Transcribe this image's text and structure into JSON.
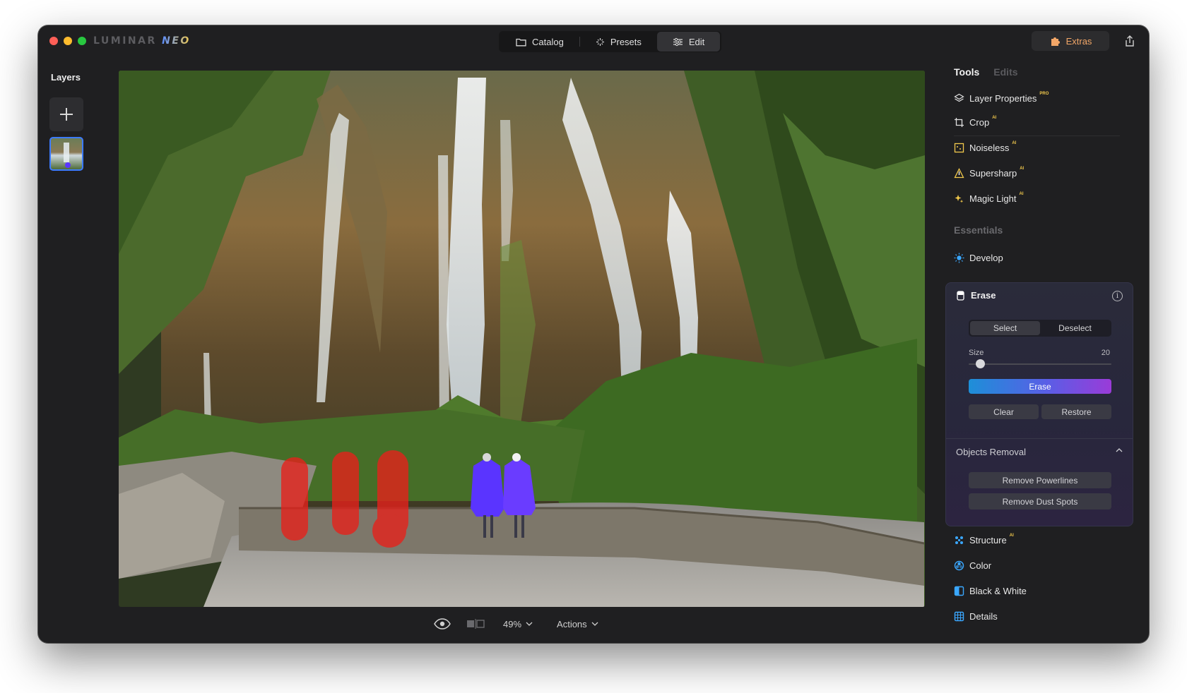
{
  "app": {
    "logo_main": "LUMINAR ",
    "logo_accent": "NEO"
  },
  "modes": [
    {
      "label": "Catalog",
      "icon": "folder-icon",
      "active": false
    },
    {
      "label": "Presets",
      "icon": "sparkle-icon",
      "active": false
    },
    {
      "label": "Edit",
      "icon": "sliders-icon",
      "active": true
    }
  ],
  "extras": {
    "label": "Extras",
    "icon": "puzzle-icon"
  },
  "layers": {
    "title": "Layers"
  },
  "bottombar": {
    "zoom": "49%",
    "actions": "Actions"
  },
  "panel": {
    "tabs": {
      "tools": "Tools",
      "edits": "Edits"
    },
    "tools": [
      {
        "label": "Layer Properties",
        "badge": "PRO"
      },
      {
        "label": "Crop",
        "badge": "AI"
      },
      {
        "label": "Noiseless",
        "badge": "AI"
      },
      {
        "label": "Supersharp",
        "badge": "AI"
      },
      {
        "label": "Magic Light",
        "badge": "AI"
      }
    ],
    "essentials_title": "Essentials",
    "develop": "Develop",
    "erase": {
      "title": "Erase",
      "select": "Select",
      "deselect": "Deselect",
      "size_label": "Size",
      "size_value": "20",
      "erase_button": "Erase",
      "clear": "Clear",
      "restore": "Restore",
      "objects_removal": "Objects Removal",
      "remove_powerlines": "Remove Powerlines",
      "remove_dust_spots": "Remove Dust Spots"
    },
    "lower_tools": [
      {
        "label": "Structure",
        "badge": "AI"
      },
      {
        "label": "Color",
        "badge": ""
      },
      {
        "label": "Black & White",
        "badge": ""
      },
      {
        "label": "Details",
        "badge": ""
      }
    ]
  },
  "colors": {
    "accent": "#3c7bff",
    "extras": "#f3a768",
    "erase_gradient_start": "#1d8fd8",
    "erase_gradient_end": "#9a3bd8"
  }
}
